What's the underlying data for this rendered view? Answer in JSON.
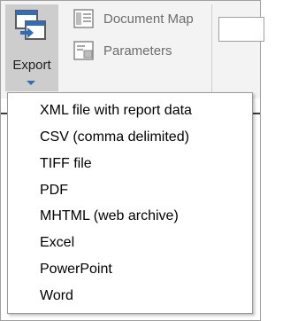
{
  "ribbon": {
    "export_label": "Export",
    "document_map_label": "Document Map",
    "parameters_label": "Parameters"
  },
  "export_menu": {
    "items": [
      {
        "label": "XML file with report data"
      },
      {
        "label": "CSV (comma delimited)"
      },
      {
        "label": "TIFF file"
      },
      {
        "label": "PDF"
      },
      {
        "label": "MHTML (web archive)"
      },
      {
        "label": "Excel"
      },
      {
        "label": "PowerPoint"
      },
      {
        "label": "Word"
      }
    ]
  },
  "icons": {
    "export": "export-icon",
    "document_map": "document-map-icon",
    "parameters": "parameters-icon",
    "dropdown_arrow": "chevron-down-icon"
  },
  "colors": {
    "accent_blue": "#2f6cc0",
    "export_button_bg": "#cdcdcd",
    "ribbon_bg": "#f3f3f3",
    "disabled_text": "#6d6d6d"
  }
}
